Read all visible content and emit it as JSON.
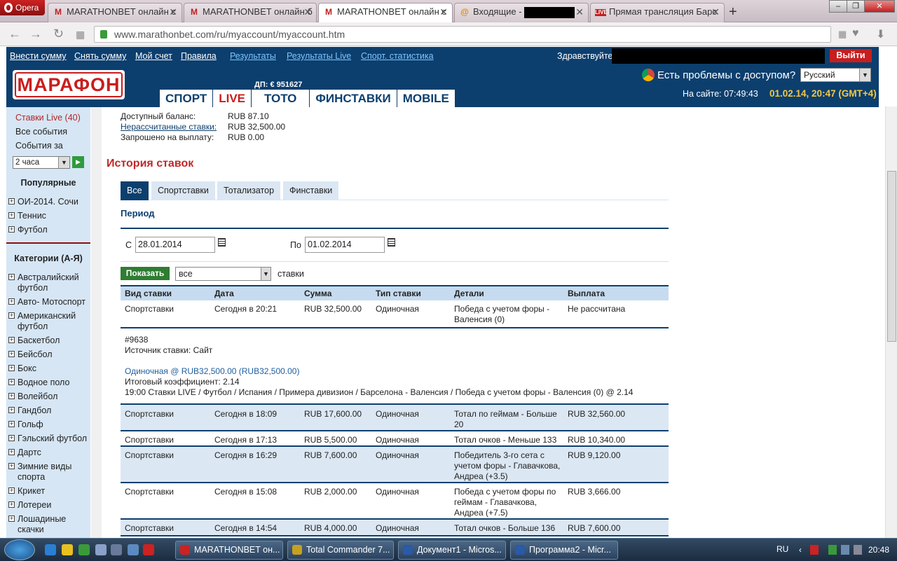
{
  "browser": {
    "app": "Opera",
    "tabs": [
      "MARATHONBET онлайн с",
      "MARATHONBET онлайн б",
      "MARATHONBET онлайн с",
      "Входящие -",
      "Прямая трансляция Барс"
    ],
    "url": "www.marathonbet.com/ru/myaccount/myaccount.htm"
  },
  "topnav": {
    "links": [
      "Внести сумму",
      "Снять сумму",
      "Мой счет",
      "Правила",
      "Результаты",
      "Результаты Live",
      "Спорт. статистика"
    ],
    "greeting": "Здравствуйте,",
    "logout": "Выйти"
  },
  "header": {
    "logo": "МАРАФОН",
    "dp": "ДП: € 951627",
    "nav": [
      "СПОРТ",
      "LIVE",
      "ТОТО",
      "ФИНСТАВКИ",
      "MOBILE"
    ],
    "access": "Есть проблемы с доступом?",
    "language": "Русский",
    "on_site": "На сайте: 07:49:43",
    "datetime": "01.02.14, 20:47 (GMT+4)"
  },
  "sidebar": {
    "live": "Ставки Live (40)",
    "all": "Все события",
    "events_for": "События за",
    "period": "2 часа",
    "popular_title": "Популярные",
    "popular": [
      "ОИ-2014. Сочи",
      "Теннис",
      "Футбол"
    ],
    "categories_title": "Категории (А-Я)",
    "categories": [
      "Австралийский футбол",
      "Авто- Мотоспорт",
      "Американский футбол",
      "Баскетбол",
      "Бейсбол",
      "Бокс",
      "Водное поло",
      "Волейбол",
      "Гандбол",
      "Гольф",
      "Гэльский футбол",
      "Дартс",
      "Зимние виды спорта",
      "Крикет",
      "Лотереи",
      "Лошадиные скачки"
    ]
  },
  "balance": {
    "available_label": "Доступный баланс:",
    "available": "RUB 87.10",
    "unsettled_label": "Нерассчитанные ставки:",
    "unsettled": "RUB 32,500.00",
    "requested_label": "Запрошено на выплату:",
    "requested": "RUB 0.00"
  },
  "history": {
    "title": "История ставок",
    "tabs": [
      "Все",
      "Спортставки",
      "Тотализатор",
      "Финставки"
    ],
    "period_label": "Период",
    "from_label": "С",
    "from": "28.01.2014",
    "to_label": "По",
    "to": "01.02.2014",
    "show_button": "Показать",
    "filter": "все",
    "filter_suffix": "ставки"
  },
  "table": {
    "headers": [
      "Вид ставки",
      "Дата",
      "Сумма",
      "Тип ставки",
      "Детали",
      "Выплата"
    ],
    "rows": [
      {
        "kind": "Спортставки",
        "date": "Сегодня в 20:21",
        "sum": "RUB 32,500.00",
        "type": "Одиночная",
        "details": "Победа с учетом форы - Валенсия (0)",
        "payout": "Не рассчитана"
      },
      {
        "kind": "Спортставки",
        "date": "Сегодня в 18:09",
        "sum": "RUB 17,600.00",
        "type": "Одиночная",
        "details": "Тотал по геймам - Больше 20",
        "payout": "RUB 32,560.00"
      },
      {
        "kind": "Спортставки",
        "date": "Сегодня в 17:13",
        "sum": "RUB 5,500.00",
        "type": "Одиночная",
        "details": "Тотал очков - Меньше 133",
        "payout": "RUB 10,340.00"
      },
      {
        "kind": "Спортставки",
        "date": "Сегодня в 16:29",
        "sum": "RUB 7,600.00",
        "type": "Одиночная",
        "details": "Победитель 3-го сета с учетом форы - Главачкова, Андреа (+3.5)",
        "payout": "RUB 9,120.00"
      },
      {
        "kind": "Спортставки",
        "date": "Сегодня в 15:08",
        "sum": "RUB 2,000.00",
        "type": "Одиночная",
        "details": "Победа с учетом форы по геймам - Главачкова, Андреа (+7.5)",
        "payout": "RUB 3,666.00"
      },
      {
        "kind": "Спортставки",
        "date": "Сегодня в 14:54",
        "sum": "RUB 4,000.00",
        "type": "Одиночная",
        "details": "Тотал очков - Больше 136",
        "payout": "RUB 7,600.00"
      }
    ],
    "detail": {
      "id": "#9638",
      "source": "Источник ставки: Сайт",
      "single": "Одиночная @ RUB32,500.00 (RUB32,500.00)",
      "coef": "Итоговый коэффициент: 2.14",
      "event": "19:00 Ставки LIVE / Футбол / Испания / Примера дивизион / Барселона - Валенсия / Победа с учетом форы - Валенсия (0) @ 2.14"
    }
  },
  "taskbar": {
    "items": [
      "MARATHONBET он...",
      "Total Commander 7...",
      "Документ1 - Micros...",
      "Программа2 - Micr..."
    ],
    "lang": "RU",
    "clock": "20:48"
  }
}
